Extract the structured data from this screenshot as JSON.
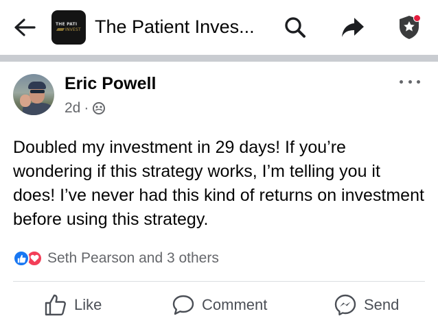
{
  "header": {
    "back_icon": "arrow-left-icon",
    "logo_text_top": "THE PATI",
    "logo_text_bottom": "INVEST",
    "title": "The Patient Inves...",
    "search_icon": "search-icon",
    "share_icon": "share-arrow-icon",
    "shield_icon": "shield-star-icon",
    "notification_color": "#e41e3f"
  },
  "post": {
    "author": "Eric Powell",
    "time": "2d",
    "separator": "·",
    "privacy_icon": "group-members-icon",
    "more_icon": "more-dots-icon",
    "text": "Doubled my investment in 29 days! If you’re wondering if this strategy works, I’m telling you it does! I’ve never had this kind of returns on investment before using this strategy.",
    "reactions": {
      "icons": [
        "like-reaction-icon",
        "love-reaction-icon"
      ],
      "summary": "Seth Pearson and 3 others"
    }
  },
  "actions": {
    "like": "Like",
    "comment": "Comment",
    "send": "Send"
  },
  "colors": {
    "like_blue": "#1877f2",
    "love_red": "#f33e58",
    "secondary_text": "#65676b"
  }
}
